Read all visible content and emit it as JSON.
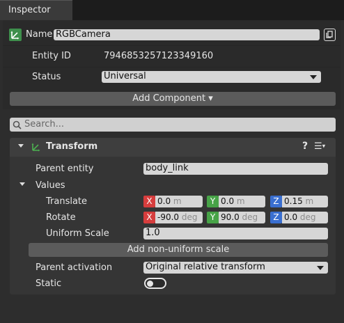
{
  "tab": {
    "title": "Inspector"
  },
  "entity": {
    "name_label": "Name",
    "name_value": "RGBCamera",
    "id_label": "Entity ID",
    "id_value": "7946853257123349160",
    "status_label": "Status",
    "status_value": "Universal"
  },
  "add_component_label": "Add Component ▾",
  "search": {
    "placeholder": "Search..."
  },
  "transform": {
    "title": "Transform",
    "help_label": "?",
    "menu_label": "☰",
    "parent_entity_label": "Parent entity",
    "parent_entity_value": "body_link",
    "values_label": "Values",
    "translate_label": "Translate",
    "translate": {
      "x": "0.0",
      "y": "0.0",
      "z": "0.15",
      "unit": "m"
    },
    "rotate_label": "Rotate",
    "rotate": {
      "x": "-90.0",
      "y": "90.0",
      "z": "0.0",
      "unit": "deg"
    },
    "uniform_scale_label": "Uniform Scale",
    "uniform_scale_value": "1.0",
    "add_nonuniform_label": "Add non-uniform scale",
    "parent_activation_label": "Parent activation",
    "parent_activation_value": "Original relative transform",
    "static_label": "Static",
    "static_enabled": false
  },
  "axis_labels": {
    "x": "X",
    "y": "Y",
    "z": "Z"
  },
  "colors": {
    "axis_x": "#d63d3d",
    "axis_y": "#47a347",
    "axis_z": "#3a6fd0",
    "transform_icon": "#3e8f4c"
  }
}
